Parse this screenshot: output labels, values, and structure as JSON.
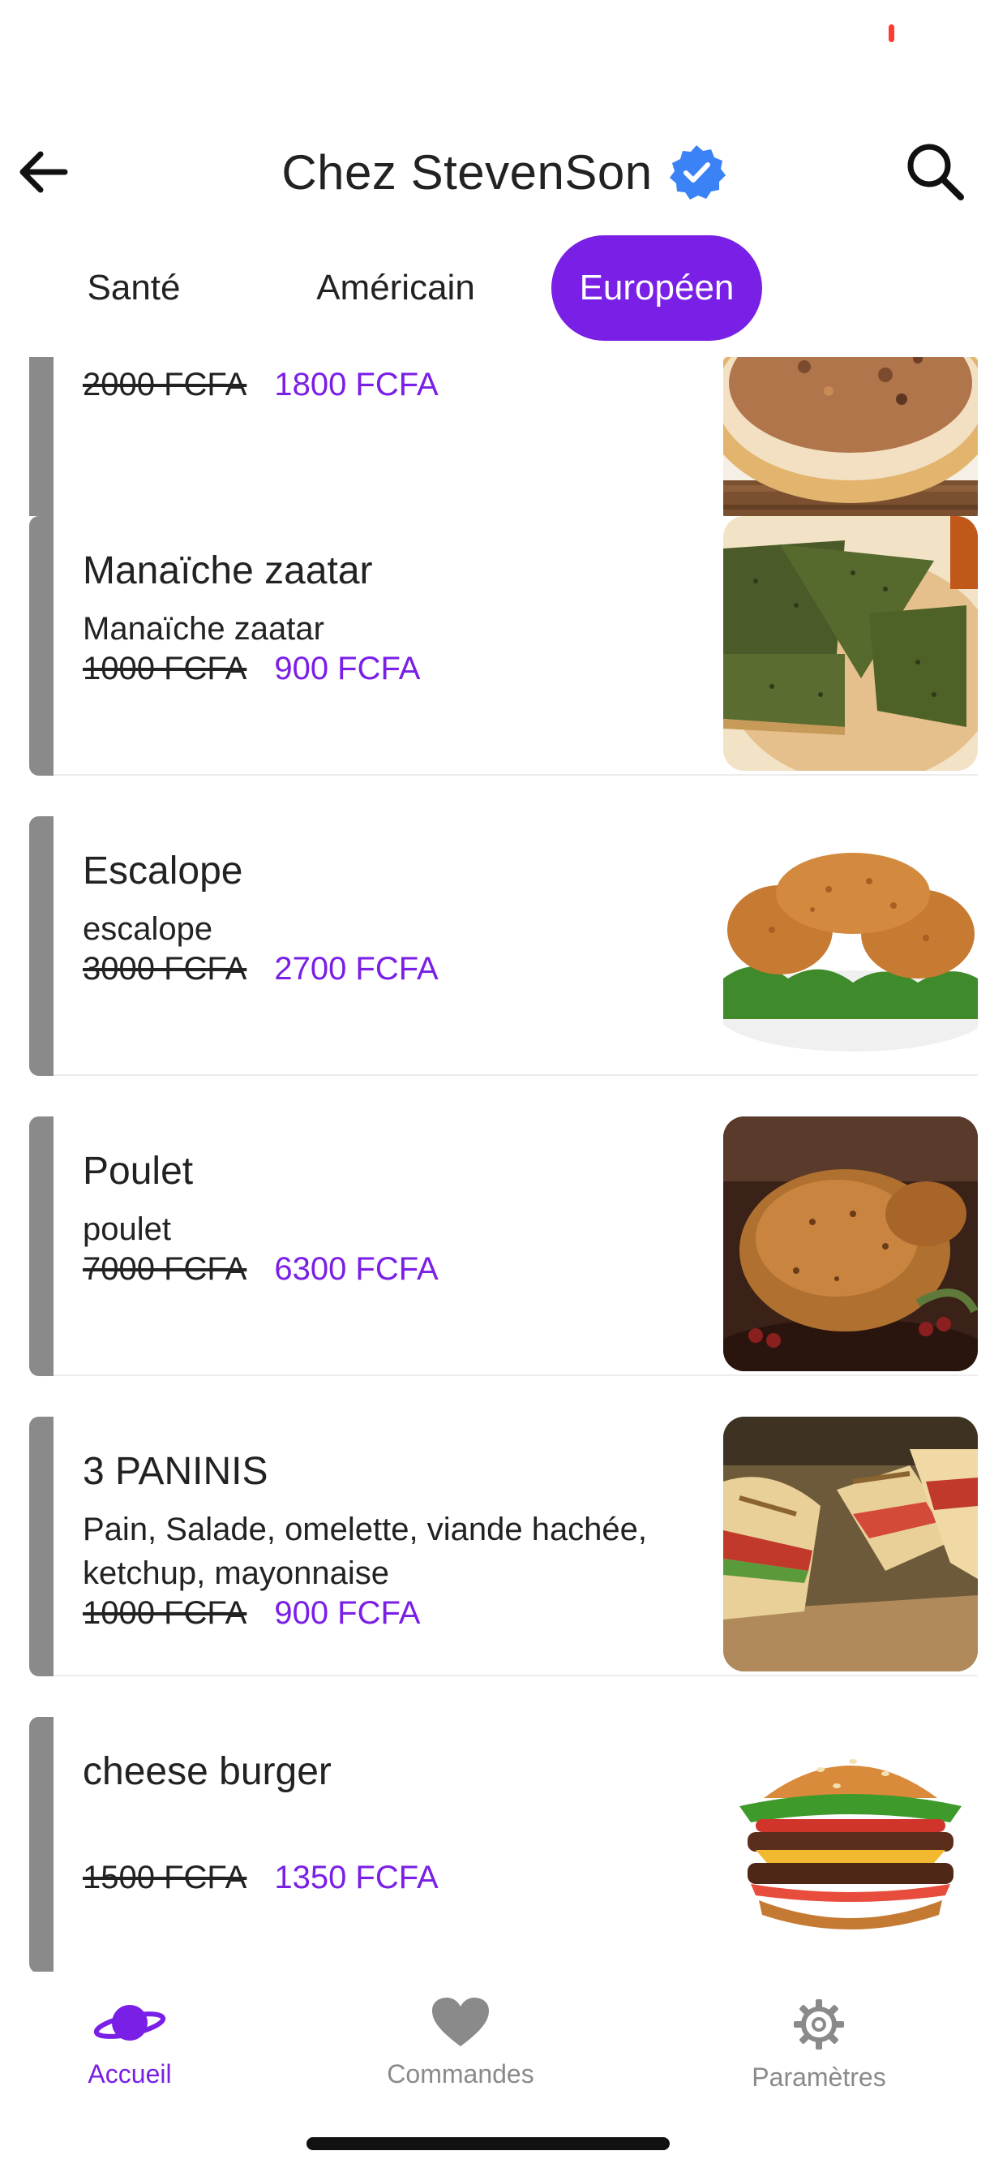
{
  "header": {
    "title": "Chez StevenSon"
  },
  "tabs": [
    {
      "label": "Santé"
    },
    {
      "label": "Américain"
    },
    {
      "label": "Européen"
    }
  ],
  "items": [
    {
      "name": "",
      "description": "",
      "old_price": "2000 FCFA",
      "new_price": "1800 FCFA",
      "image": "pizza"
    },
    {
      "name": "Manaïche zaatar",
      "description": "Manaïche zaatar",
      "old_price": "1000 FCFA",
      "new_price": "900 FCFA",
      "image": "manaiche-zaatar"
    },
    {
      "name": "Escalope",
      "description": "escalope",
      "old_price": "3000 FCFA",
      "new_price": "2700 FCFA",
      "image": "escalope"
    },
    {
      "name": "Poulet",
      "description": "poulet",
      "old_price": "7000 FCFA",
      "new_price": "6300 FCFA",
      "image": "roast-chicken"
    },
    {
      "name": "3 PANINIS",
      "description": "Pain, Salade, omelette, viande hachée, ketchup, mayonnaise",
      "old_price": "1000 FCFA",
      "new_price": "900 FCFA",
      "image": "panini"
    },
    {
      "name": "cheese burger",
      "description": "",
      "old_price": "1500 FCFA",
      "new_price": "1350 FCFA",
      "image": "cheeseburger"
    }
  ],
  "bottom_nav": [
    {
      "label": "Accueil",
      "icon": "planet-icon"
    },
    {
      "label": "Commandes",
      "icon": "heart-icon"
    },
    {
      "label": "Paramètres",
      "icon": "gear-icon"
    }
  ],
  "colors": {
    "accent": "#7a1fe6",
    "bar": "#8a8a8a",
    "verified": "#3b82f6"
  }
}
